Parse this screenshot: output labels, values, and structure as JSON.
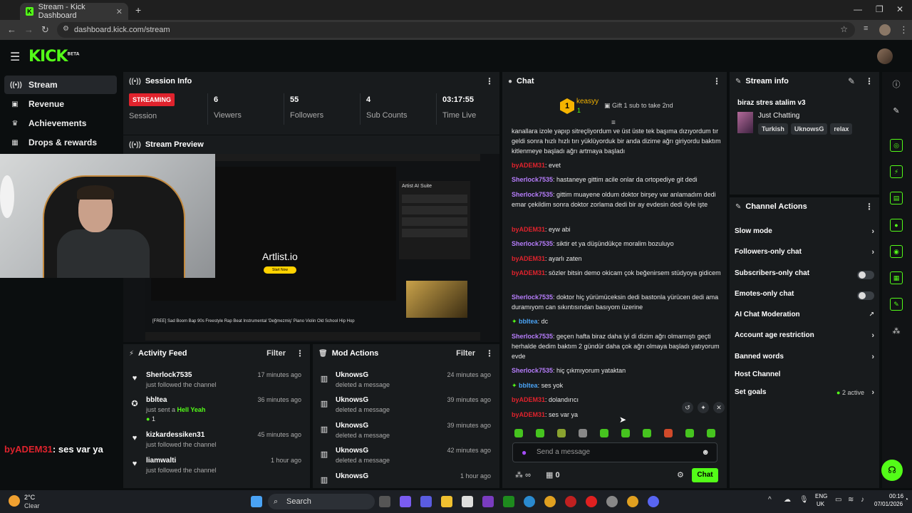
{
  "browser": {
    "tab_title": "Stream - Kick Dashboard",
    "url": "dashboard.kick.com/stream"
  },
  "app": {
    "logo": "KICK",
    "logo_beta": "BETA"
  },
  "nav": [
    {
      "label": "Stream",
      "icon": "broadcast-icon"
    },
    {
      "label": "Revenue",
      "icon": "wallet-icon"
    },
    {
      "label": "Achievements",
      "icon": "trophy-icon"
    },
    {
      "label": "Drops & rewards",
      "icon": "gift-icon"
    }
  ],
  "session": {
    "title": "Session Info",
    "status": "STREAMING",
    "session_label": "Session",
    "viewers": "6",
    "viewers_label": "Viewers",
    "followers": "55",
    "followers_label": "Followers",
    "subs": "4",
    "subs_label": "Sub Counts",
    "time": "03:17:55",
    "time_label": "Time Live"
  },
  "preview": {
    "title": "Stream Preview",
    "artlist": "Artlist.io",
    "start_now": "Start Now",
    "ai_suite": "Artist AI Suite",
    "video_title": "[FREE] Sad Boom Bap 90s Freestyle Rap Beat Instrumental 'Değmezmiş' Piano Violin Old School Hip Hop"
  },
  "overlay_chat": {
    "user": "byADEM31",
    "message": ": ses var ya"
  },
  "activity": {
    "title": "Activity Feed",
    "filter": "Filter",
    "items": [
      {
        "name": "Sherlock7535",
        "sub": "just followed the channel",
        "time": "17 minutes ago"
      },
      {
        "name": "bbltea",
        "sub": "just sent a",
        "highlight": "Hell Yeah",
        "count": "1",
        "time": "36 minutes ago"
      },
      {
        "name": "kizkardessiken31",
        "sub": "just followed the channel",
        "time": "45 minutes ago"
      },
      {
        "name": "liamwalti",
        "sub": "just followed the channel",
        "time": "1 hour ago"
      }
    ]
  },
  "mod": {
    "title": "Mod Actions",
    "filter": "Filter",
    "items": [
      {
        "name": "UknowsG",
        "sub": "deleted a message",
        "time": "24 minutes ago"
      },
      {
        "name": "UknowsG",
        "sub": "deleted a message",
        "time": "39 minutes ago"
      },
      {
        "name": "UknowsG",
        "sub": "deleted a message",
        "time": "39 minutes ago"
      },
      {
        "name": "UknowsG",
        "sub": "deleted a message",
        "time": "42 minutes ago"
      },
      {
        "name": "UknowsG",
        "sub": "",
        "time": "1 hour ago"
      }
    ]
  },
  "chat": {
    "title": "Chat",
    "top_gifter": "keasyy",
    "top_gifter_count": "1",
    "gift_prompt": "Gift 1 sub to take 2nd",
    "messages": [
      {
        "user": "",
        "text": "kanallara izole yapıp sitreçliyordum ve üst üste tek başıma dızıyordum tır geldi sonra hızlı hızlı tırı yüklüyorduk bir anda dizime ağrı giriyordu baktım kitlenmeye başladı ağrı artmaya başladı",
        "cls": "u-red"
      },
      {
        "user": "byADEM31",
        "text": ": evet",
        "cls": "u-red"
      },
      {
        "user": "Sherlock7535",
        "text": ": hastaneye gittim acile onlar da ortopediye git dedi",
        "cls": "u-purple"
      },
      {
        "user": "Sherlock7535",
        "text": ": gittim muayene oldum doktor birşey var anlamadım dedi emar çekildim sonra doktor zorlama dedi bir ay evdesin dedi öyle işte",
        "cls": "u-purple"
      },
      {
        "user": "byADEM31",
        "text": ": eyw abi",
        "cls": "u-red"
      },
      {
        "user": "Sherlock7535",
        "text": ": siktir et ya düşündükçe moralim bozuluyo",
        "cls": "u-purple"
      },
      {
        "user": "byADEM31",
        "text": ": ayarlı zaten",
        "cls": "u-red"
      },
      {
        "user": "byADEM31",
        "text": ": sözler bitsin demo okicam çok beğenirsem stüdyoya gidicem",
        "cls": "u-red"
      },
      {
        "user": "Sherlock7535",
        "text": ": doktor hiç yürümüceksin dedi bastonla yürücen dedi ama duramıyom can sıkıntısından basıyom üzerine",
        "cls": "u-purple"
      },
      {
        "user": "bbltea",
        "text": ": dc",
        "cls": "u-blue"
      },
      {
        "user": "Sherlock7535",
        "text": ": geçen hafta biraz daha iyi di dizim ağrı olmamıştı geçti herhalde dedim baktım 2 gündür daha çok ağrı olmaya başladı yatıyorum evde",
        "cls": "u-purple"
      },
      {
        "user": "Sherlock7535",
        "text": ": hiç çıkmıyorum yataktan",
        "cls": "u-purple"
      },
      {
        "user": "bbltea",
        "text": ": ses yok",
        "cls": "u-blue"
      },
      {
        "user": "byADEM31",
        "text": ": dolandırıcı",
        "cls": "u-red"
      },
      {
        "user": "byADEM31",
        "text": ": ses var ya",
        "cls": "u-red"
      }
    ],
    "input_placeholder": "Send a message",
    "infinity": "∞",
    "points": "0",
    "send_label": "Chat"
  },
  "stream_info": {
    "title": "Stream info",
    "stream_title": "biraz stres atalim v3",
    "category": "Just Chatting",
    "tags": [
      "Turkish",
      "UknowsG",
      "relax"
    ]
  },
  "channel_actions": {
    "title": "Channel Actions",
    "rows": [
      {
        "label": "Slow mode",
        "type": "arrow"
      },
      {
        "label": "Followers-only chat",
        "type": "arrow"
      },
      {
        "label": "Subscribers-only chat",
        "type": "toggle"
      },
      {
        "label": "Emotes-only chat",
        "type": "toggle"
      },
      {
        "label": "AI Chat Moderation",
        "type": "external"
      },
      {
        "label": "Account age restriction",
        "type": "arrow"
      },
      {
        "label": "Banned words",
        "type": "arrow"
      },
      {
        "label": "Host Channel",
        "type": "none"
      },
      {
        "label": "Set goals",
        "type": "arrow",
        "extra": "2 active"
      }
    ]
  },
  "taskbar": {
    "weather_temp": "2°C",
    "weather_desc": "Clear",
    "search": "Search",
    "lang": "ENG",
    "region": "UK",
    "time": "00:16",
    "date": "07/01/2026"
  },
  "colors": {
    "accent": "#53fc18",
    "streaming": "#e0232d",
    "panel": "#181b1d"
  }
}
